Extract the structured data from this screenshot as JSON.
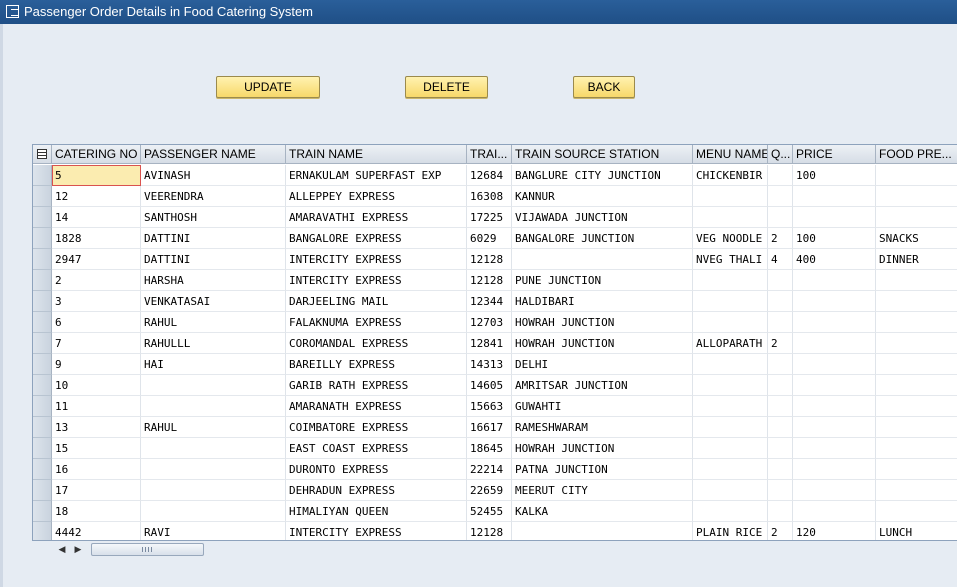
{
  "window": {
    "title": "Passenger Order Details in Food Catering System"
  },
  "toolbar": {
    "update_label": "UPDATE",
    "delete_label": "DELETE",
    "back_label": "BACK"
  },
  "grid": {
    "columns": [
      "CATERING NO",
      "PASSENGER NAME",
      "TRAIN NAME",
      "TRAI...",
      "TRAIN SOURCE STATION",
      "MENU NAME",
      "Q...",
      "PRICE",
      "FOOD PRE..."
    ],
    "rows": [
      [
        "5",
        "AVINASH",
        "ERNAKULAM SUPERFAST EXP",
        "12684",
        "BANGLURE CITY JUNCTION",
        "CHICKENBIR",
        "",
        "100",
        ""
      ],
      [
        "12",
        "VEERENDRA",
        "ALLEPPEY EXPRESS",
        "16308",
        "KANNUR",
        "",
        "",
        "",
        ""
      ],
      [
        "14",
        "SANTHOSH",
        "AMARAVATHI EXPRESS",
        "17225",
        "VIJAWADA JUNCTION",
        "",
        "",
        "",
        ""
      ],
      [
        "1828",
        "DATTINI",
        "BANGALORE EXPRESS",
        "6029",
        "BANGALORE JUNCTION",
        "VEG NOODLE",
        "2",
        "100",
        "SNACKS"
      ],
      [
        "2947",
        "DATTINI",
        "INTERCITY EXPRESS",
        "12128",
        "",
        "NVEG THALI",
        "4",
        "400",
        "DINNER"
      ],
      [
        "2",
        "HARSHA",
        "INTERCITY EXPRESS",
        "12128",
        "PUNE JUNCTION",
        "",
        "",
        "",
        ""
      ],
      [
        "3",
        "VENKATASAI",
        "DARJEELING MAIL",
        "12344",
        "HALDIBARI",
        "",
        "",
        "",
        ""
      ],
      [
        "6",
        "RAHUL",
        "FALAKNUMA EXPRESS",
        "12703",
        "HOWRAH JUNCTION",
        "",
        "",
        "",
        ""
      ],
      [
        "7",
        "RAHULLL",
        "COROMANDAL EXPRESS",
        "12841",
        "HOWRAH JUNCTION",
        "ALLOPARATH",
        "2",
        "",
        ""
      ],
      [
        "9",
        "HAI",
        "BAREILLY EXPRESS",
        "14313",
        "DELHI",
        "",
        "",
        "",
        ""
      ],
      [
        "10",
        "",
        "GARIB RATH EXPRESS",
        "14605",
        "AMRITSAR JUNCTION",
        "",
        "",
        "",
        ""
      ],
      [
        "11",
        "",
        "AMARANATH EXPRESS",
        "15663",
        "GUWAHTI",
        "",
        "",
        "",
        ""
      ],
      [
        "13",
        "RAHUL",
        "COIMBATORE EXPRESS",
        "16617",
        "RAMESHWARAM",
        "",
        "",
        "",
        ""
      ],
      [
        "15",
        "",
        "EAST COAST EXPRESS",
        "18645",
        "HOWRAH JUNCTION",
        "",
        "",
        "",
        ""
      ],
      [
        "16",
        "",
        "DURONTO EXPRESS",
        "22214",
        "PATNA JUNCTION",
        "",
        "",
        "",
        ""
      ],
      [
        "17",
        "",
        "DEHRADUN EXPRESS",
        "22659",
        "MEERUT CITY",
        "",
        "",
        "",
        ""
      ],
      [
        "18",
        "",
        "HIMALIYAN QUEEN",
        "52455",
        "KALKA",
        "",
        "",
        "",
        ""
      ],
      [
        "4442",
        "RAVI",
        "INTERCITY EXPRESS",
        "12128",
        "",
        "PLAIN RICE",
        "2",
        "120",
        "LUNCH"
      ]
    ]
  },
  "scrollbar": {
    "left_icon": "triangle-left-icon",
    "right_icon": "triangle-right-icon"
  },
  "colors": {
    "title_bar": "#2a5f9a",
    "button": "#f7d86a",
    "focus_cell": "#fbecb0",
    "focus_border": "#d9534f"
  }
}
